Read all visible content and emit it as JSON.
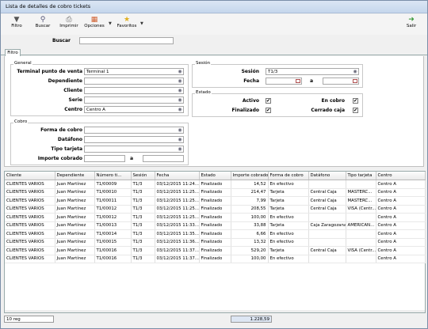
{
  "window": {
    "title": "Lista de detalles de cobro tickets"
  },
  "toolbar": {
    "filter": "Filtro",
    "search": "Buscar",
    "print": "Imprimir",
    "options": "Opciones",
    "favorites": "Favoritos",
    "exit": "Salir"
  },
  "search": {
    "label": "Buscar",
    "value": ""
  },
  "tabs": {
    "filter": "Filtro"
  },
  "general": {
    "title": "General",
    "pos_label": "Terminal punto de venta",
    "pos_value": "Terminal 1",
    "employee_label": "Dependiente",
    "employee_value": "",
    "customer_label": "Cliente",
    "customer_value": "",
    "series_label": "Serie",
    "series_value": "",
    "center_label": "Centro",
    "center_value": "Centro A"
  },
  "session": {
    "title": "Sesión",
    "session_label": "Sesión",
    "session_value": "T1/3",
    "date_label": "Fecha",
    "date_from": "",
    "date_sep": "a",
    "date_to": ""
  },
  "status": {
    "title": "Estado",
    "active_label": "Activo",
    "active": true,
    "collecting_label": "En cobro",
    "collecting": true,
    "finished_label": "Finalizado",
    "finished": true,
    "closed_label": "Cerrado caja",
    "closed": true
  },
  "payment": {
    "title": "Cobro",
    "method_label": "Forma de cobro",
    "method_value": "",
    "dataphone_label": "Datáfono",
    "dataphone_value": "",
    "card_label": "Tipo tarjeta",
    "card_value": "",
    "amount_label": "Importe cobrado",
    "amount_from": "",
    "amount_sep": "a",
    "amount_to": ""
  },
  "table": {
    "columns": [
      "Cliente",
      "Dependiente",
      "Número ti...",
      "Sesión",
      "Fecha",
      "Estado",
      "Importe cobrado",
      "Forma de cobro",
      "Datáfono",
      "Tipo tarjeta",
      "Centro"
    ],
    "rows": [
      [
        "CLIENTES VARIOS",
        "Juan Martínez",
        "T1/00009",
        "T1/3",
        "03/12/2015 11:24...",
        "Finalizado",
        "14,52",
        "En efectivo",
        "",
        "",
        "Centro A"
      ],
      [
        "CLIENTES VARIOS",
        "Juan Martínez",
        "T1/00010",
        "T1/3",
        "03/12/2015 11:25...",
        "Finalizado",
        "214,47",
        "Tarjeta",
        "Central Caja",
        "MASTERC...",
        "Centro A"
      ],
      [
        "CLIENTES VARIOS",
        "Juan Martínez",
        "T1/00011",
        "T1/3",
        "03/12/2015 11:25...",
        "Finalizado",
        "7,99",
        "Tarjeta",
        "Central Caja",
        "MASTERC...",
        "Centro A"
      ],
      [
        "CLIENTES VARIOS",
        "Juan Martínez",
        "T1/00012",
        "T1/3",
        "03/12/2015 11:25...",
        "Finalizado",
        "208,55",
        "Tarjeta",
        "Central Caja",
        "VISA (Centr...",
        "Centro A"
      ],
      [
        "CLIENTES VARIOS",
        "Juan Martínez",
        "T1/00012",
        "T1/3",
        "03/12/2015 11:25...",
        "Finalizado",
        "100,00",
        "En efectivo",
        "",
        "",
        "Centro A"
      ],
      [
        "CLIENTES VARIOS",
        "Juan Martínez",
        "T1/00013",
        "T1/3",
        "03/12/2015 11:33...",
        "Finalizado",
        "33,88",
        "Tarjeta",
        "Caja Zaragozana",
        "AMERICAN...",
        "Centro A"
      ],
      [
        "CLIENTES VARIOS",
        "Juan Martínez",
        "T1/00014",
        "T1/3",
        "03/12/2015 11:35...",
        "Finalizado",
        "6,66",
        "En efectivo",
        "",
        "",
        "Centro A"
      ],
      [
        "CLIENTES VARIOS",
        "Juan Martínez",
        "T1/00015",
        "T1/3",
        "03/12/2015 11:36...",
        "Finalizado",
        "13,32",
        "En efectivo",
        "",
        "",
        "Centro A"
      ],
      [
        "CLIENTES VARIOS",
        "Juan Martínez",
        "T1/00016",
        "T1/3",
        "03/12/2015 11:37...",
        "Finalizado",
        "529,20",
        "Tarjeta",
        "Central Caja",
        "VISA (Centr...",
        "Centro A"
      ],
      [
        "CLIENTES VARIOS",
        "Juan Martínez",
        "T1/00016",
        "T1/3",
        "03/12/2015 11:37...",
        "Finalizado",
        "100,00",
        "En efectivo",
        "",
        "",
        "Centro A"
      ]
    ]
  },
  "footer": {
    "record_count": "10 reg",
    "total": "1.228,59"
  }
}
